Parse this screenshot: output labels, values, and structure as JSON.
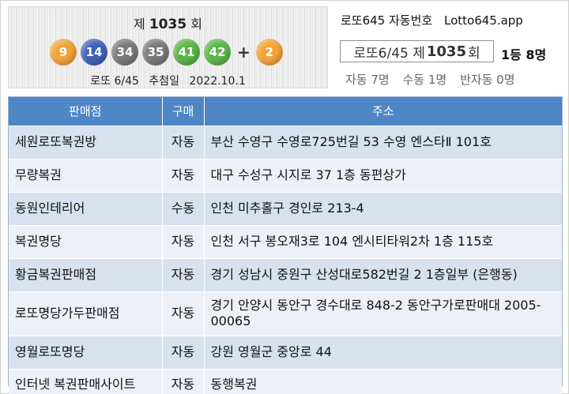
{
  "draw": {
    "title_prefix": "제",
    "round": "1035",
    "title_suffix": "회",
    "numbers": [
      {
        "value": "9",
        "color": "#f2a43a"
      },
      {
        "value": "14",
        "color": "#3f63b8"
      },
      {
        "value": "34",
        "color": "#7a7a7a"
      },
      {
        "value": "35",
        "color": "#7a7a7a"
      },
      {
        "value": "41",
        "color": "#5bb548"
      },
      {
        "value": "42",
        "color": "#5bb548"
      }
    ],
    "plus": "+",
    "bonus": {
      "value": "2",
      "color": "#f2a43a"
    },
    "game_name": "로또 6/45",
    "date_label": "추첨일",
    "date": "2022.10.1"
  },
  "info": {
    "app_title": "로또645 자동번호",
    "app_site": "Lotto645.app",
    "round_prefix": "로또6/45 제",
    "round": "1035",
    "round_suffix": "회",
    "winners": "1등 8명",
    "auto": "자동 7명",
    "manual": "수동 1명",
    "semi_auto": "반자동 0명"
  },
  "table": {
    "headers": [
      "판매점",
      "구매",
      "주소"
    ],
    "rows": [
      {
        "store": "세원로또복권방",
        "type": "자동",
        "address": "부산 수영구 수영로725번길 53 수영 엔스타Ⅱ 101호"
      },
      {
        "store": "무량복권",
        "type": "자동",
        "address": "대구 수성구 시지로 37 1층 동편상가"
      },
      {
        "store": "동원인테리어",
        "type": "수동",
        "address": "인천 미추홀구 경인로 213-4"
      },
      {
        "store": "복권명당",
        "type": "자동",
        "address": "인천 서구 봉오재3로 104 엔시티타워2차 1층 115호"
      },
      {
        "store": "황금복권판매점",
        "type": "자동",
        "address": "경기 성남시 중원구 산성대로582번길 2 1층일부 (은행동)"
      },
      {
        "store": "로또명당가두판매점",
        "type": "자동",
        "address": "경기 안양시 동안구 경수대로 848-2 동안구가로판매대 2005-00065"
      },
      {
        "store": "영월로또명당",
        "type": "자동",
        "address": "강원 영월군 중앙로 44"
      },
      {
        "store": "인터넷 복권판매사이트",
        "type": "자동",
        "address": "동행복권"
      }
    ]
  }
}
